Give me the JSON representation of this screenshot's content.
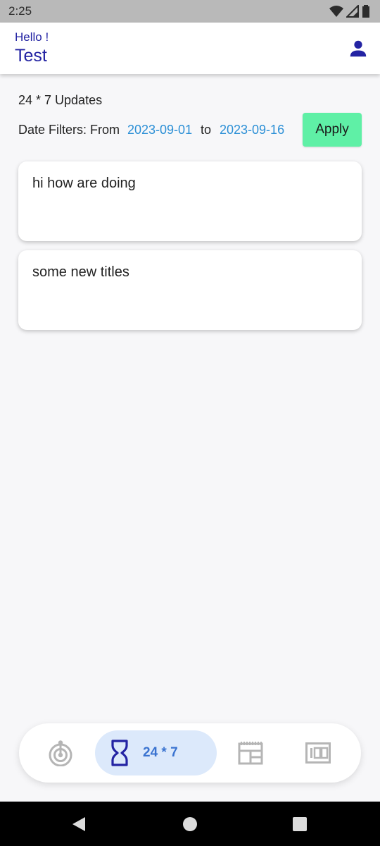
{
  "status_bar": {
    "time": "2:25",
    "icons": [
      "wifi-icon",
      "signal-icon",
      "battery-icon"
    ]
  },
  "header": {
    "greeting": "Hello !",
    "username": "Test",
    "profile_icon": "person-icon"
  },
  "main": {
    "section_title": "24 * 7 Updates",
    "filter": {
      "label": "Date Filters: From",
      "from_date": "2023-09-01",
      "to_label": "to",
      "to_date": "2023-09-16",
      "apply_label": "Apply"
    },
    "cards": [
      {
        "text": "hi how are doing"
      },
      {
        "text": "some new titles"
      }
    ]
  },
  "bottom_nav": {
    "items": [
      {
        "icon": "radar-icon",
        "label": ""
      },
      {
        "icon": "hourglass-icon",
        "label": "24 * 7",
        "active": true
      },
      {
        "icon": "calendar-icon",
        "label": ""
      },
      {
        "icon": "counter-icon",
        "label": ""
      }
    ]
  },
  "colors": {
    "accent": "#2323a3",
    "link": "#2b8fd6",
    "apply_button": "#5ff0a6",
    "nav_active_bg": "#dce9fb",
    "nav_active_text": "#3a73d0"
  }
}
